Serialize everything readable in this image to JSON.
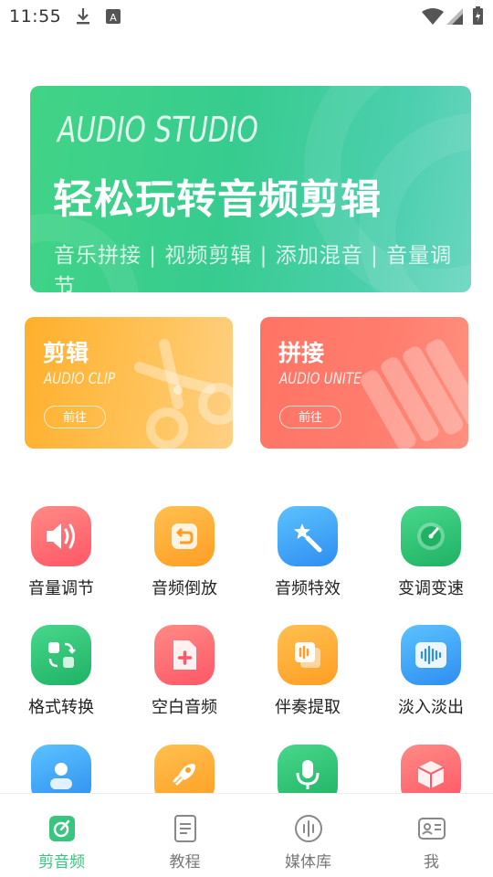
{
  "status_bar": {
    "time": "11:55"
  },
  "banner": {
    "title_en": "AUDIO STUDIO",
    "title_cn": "轻松玩转音频剪辑",
    "subtitle": "音乐拼接 | 视频剪辑 | 添加混音 | 音量调节"
  },
  "cards": {
    "clip": {
      "title": "剪辑",
      "subtitle": "AUDIO CLIP",
      "button": "前往"
    },
    "unite": {
      "title": "拼接",
      "subtitle": "AUDIO UNITE",
      "button": "前往"
    }
  },
  "tools": [
    {
      "label": "音量调节",
      "icon": "volume-icon",
      "color": "#ff6b73"
    },
    {
      "label": "音频倒放",
      "icon": "reverse-icon",
      "color": "#ffa935"
    },
    {
      "label": "音频特效",
      "icon": "magic-wand-icon",
      "color": "#3fa6f5"
    },
    {
      "label": "变调变速",
      "icon": "speedometer-icon",
      "color": "#2fc277"
    },
    {
      "label": "格式转换",
      "icon": "convert-icon",
      "color": "#2fc277"
    },
    {
      "label": "空白音频",
      "icon": "blank-file-icon",
      "color": "#ff6b73"
    },
    {
      "label": "伴奏提取",
      "icon": "extract-icon",
      "color": "#ffa935"
    },
    {
      "label": "淡入淡出",
      "icon": "waveform-icon",
      "color": "#3fa6f5"
    },
    {
      "label": "",
      "icon": "voice-icon",
      "color": "#3fa6f5"
    },
    {
      "label": "",
      "icon": "rocket-icon",
      "color": "#ffa935"
    },
    {
      "label": "",
      "icon": "microphone-icon",
      "color": "#2fc277"
    },
    {
      "label": "",
      "icon": "box-icon",
      "color": "#ff6b73"
    }
  ],
  "tabbar": {
    "tabs": [
      {
        "label": "剪音频",
        "icon": "edit-audio-icon",
        "active": true
      },
      {
        "label": "教程",
        "icon": "tutorial-icon",
        "active": false
      },
      {
        "label": "媒体库",
        "icon": "media-library-icon",
        "active": false
      },
      {
        "label": "我",
        "icon": "profile-icon",
        "active": false
      }
    ]
  },
  "colors": {
    "accent": "#39c57f",
    "banner": "#3dd08a",
    "clip_card": "#ffb13a",
    "unite_card": "#ff7566"
  }
}
